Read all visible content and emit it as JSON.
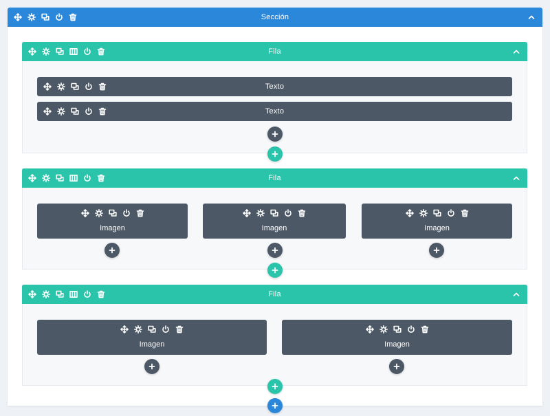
{
  "colors": {
    "section_bar": "#2b87da",
    "row_bar": "#29c4a9",
    "module": "#4c5866",
    "row_bg": "#f6f8fa",
    "page_bg": "#eef1f5"
  },
  "icons": {
    "section_tools": [
      "move-icon",
      "settings-icon",
      "duplicate-icon",
      "power-icon",
      "trash-icon"
    ],
    "row_tools": [
      "move-icon",
      "settings-icon",
      "duplicate-icon",
      "columns-icon",
      "power-icon",
      "trash-icon"
    ],
    "module_tools": [
      "move-icon",
      "settings-icon",
      "duplicate-icon",
      "power-icon",
      "trash-icon"
    ],
    "collapse": "chevron-up-icon",
    "add": "plus-icon"
  },
  "section": {
    "title": "Sección"
  },
  "rows": [
    {
      "title": "Fila",
      "modules": [
        {
          "label": "Texto"
        },
        {
          "label": "Texto"
        }
      ]
    },
    {
      "title": "Fila",
      "modules": [
        {
          "label": "Imagen"
        },
        {
          "label": "Imagen"
        },
        {
          "label": "Imagen"
        }
      ]
    },
    {
      "title": "Fila",
      "modules": [
        {
          "label": "Imagen"
        },
        {
          "label": "Imagen"
        }
      ]
    }
  ]
}
